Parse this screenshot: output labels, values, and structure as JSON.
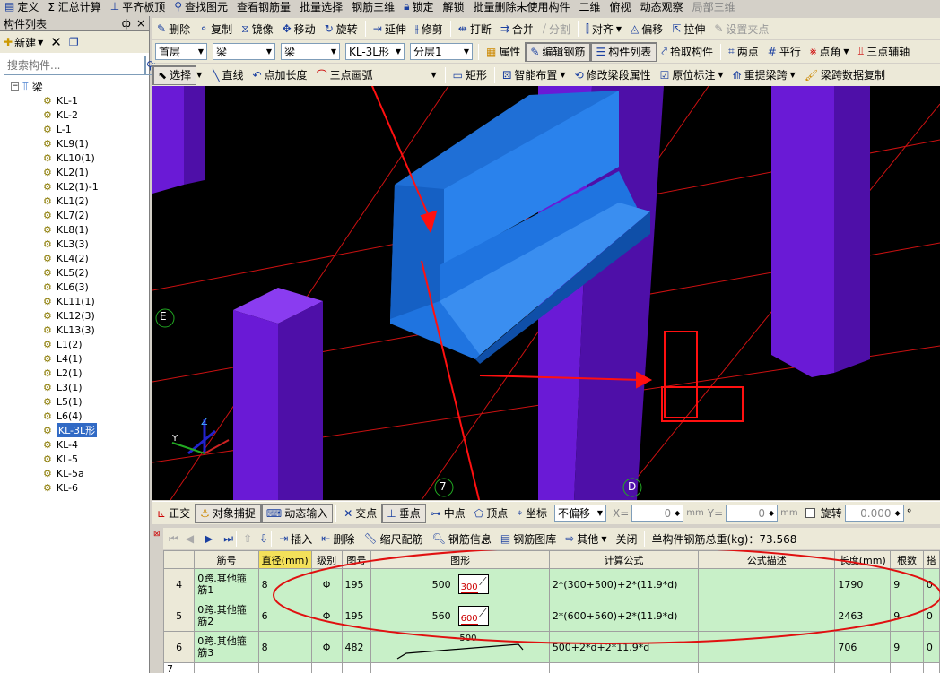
{
  "menubar": [
    "定义",
    "Σ 汇总计算",
    "平齐板顶",
    "查找图元",
    "查看钢筋量",
    "批量选择",
    "钢筋三维",
    "锁定",
    "解锁",
    "批量删除未使用构件",
    "二维",
    "俯视",
    "动态观察",
    "局部三维"
  ],
  "panel": {
    "title": "构件列表",
    "pin": "ф",
    "close": "×",
    "new_label": "新建",
    "search_placeholder": "搜索构件...",
    "root_label": "梁",
    "items": [
      "KL-1",
      "KL-2",
      "L-1",
      "KL9(1)",
      "KL10(1)",
      "KL2(1)",
      "KL2(1)-1",
      "KL1(2)",
      "KL7(2)",
      "KL8(1)",
      "KL3(3)",
      "KL4(2)",
      "KL5(2)",
      "KL6(3)",
      "KL11(1)",
      "KL12(3)",
      "KL13(3)",
      "L1(2)",
      "L4(1)",
      "L2(1)",
      "L3(1)",
      "L5(1)",
      "L6(4)",
      "KL-3L形",
      "KL-4",
      "KL-5",
      "KL-5a",
      "KL-6"
    ],
    "selected": "KL-3L形"
  },
  "tb1": [
    "删除",
    "复制",
    "镜像",
    "移动",
    "旋转",
    "延伸",
    "修剪",
    "打断",
    "合并",
    "分割",
    "对齐",
    "偏移",
    "拉伸",
    "设置夹点"
  ],
  "tb2": {
    "floor": "首层",
    "type": "梁",
    "subtype": "梁",
    "component": "KL-3L形",
    "layer": "分层1",
    "buttons": [
      "属性",
      "编辑钢筋",
      "构件列表",
      "拾取构件",
      "两点",
      "平行",
      "点角",
      "三点辅轴"
    ]
  },
  "tb3": [
    "选择",
    "直线",
    "点加长度",
    "三点画弧",
    "矩形",
    "智能布置",
    "修改梁段属性",
    "原位标注",
    "重提梁跨",
    "梁跨数据复制"
  ],
  "viewport": {
    "labels": [
      "E",
      "7",
      "D"
    ]
  },
  "snapbar": {
    "buttons": [
      "正交",
      "对象捕捉",
      "动态输入",
      "交点",
      "垂点",
      "中点",
      "顶点",
      "坐标"
    ],
    "offset_mode": "不偏移",
    "x_label": "X=",
    "x_value": "0",
    "y_label": "Y=",
    "y_value": "0",
    "unit": "mm",
    "rotate_label": "旋转",
    "rotate_value": "0.000",
    "degree": "°"
  },
  "rebarbar": {
    "buttons": [
      "插入",
      "删除",
      "缩尺配筋",
      "钢筋信息",
      "钢筋图库",
      "其他",
      "关闭"
    ],
    "total_label": "单构件钢筋总重(kg)：73.568"
  },
  "grid": {
    "headers": [
      "",
      "筋号",
      "直径(mm)",
      "级别",
      "图号",
      "图形",
      "计算公式",
      "公式描述",
      "长度(mm)",
      "根数",
      "搭"
    ],
    "rows": [
      {
        "idx": "4",
        "name": "0跨.其他箍筋1",
        "dia": "8",
        "grade": "Φ",
        "fig": "195",
        "dim1": "500",
        "dim2": "300",
        "formula": "2*(300+500)+2*(11.9*d)",
        "desc": "",
        "len": "1790",
        "count": "9",
        "lap": "0"
      },
      {
        "idx": "5",
        "name": "0跨.其他箍筋2",
        "dia": "6",
        "grade": "Φ",
        "fig": "195",
        "dim1": "560",
        "dim2": "600",
        "formula": "2*(600+560)+2*(11.9*d)",
        "desc": "",
        "len": "2463",
        "count": "9",
        "lap": "0"
      },
      {
        "idx": "6",
        "name": "0跨.其他箍筋3",
        "dia": "8",
        "grade": "Φ",
        "fig": "482",
        "dim1": "500",
        "dim2": "",
        "formula": "500+2*d+2*11.9*d",
        "desc": "",
        "len": "706",
        "count": "9",
        "lap": "0"
      },
      {
        "idx": "7",
        "name": "",
        "dia": "",
        "grade": "",
        "fig": "",
        "dim1": "",
        "dim2": "",
        "formula": "",
        "desc": "",
        "len": "",
        "count": "",
        "lap": ""
      }
    ]
  }
}
